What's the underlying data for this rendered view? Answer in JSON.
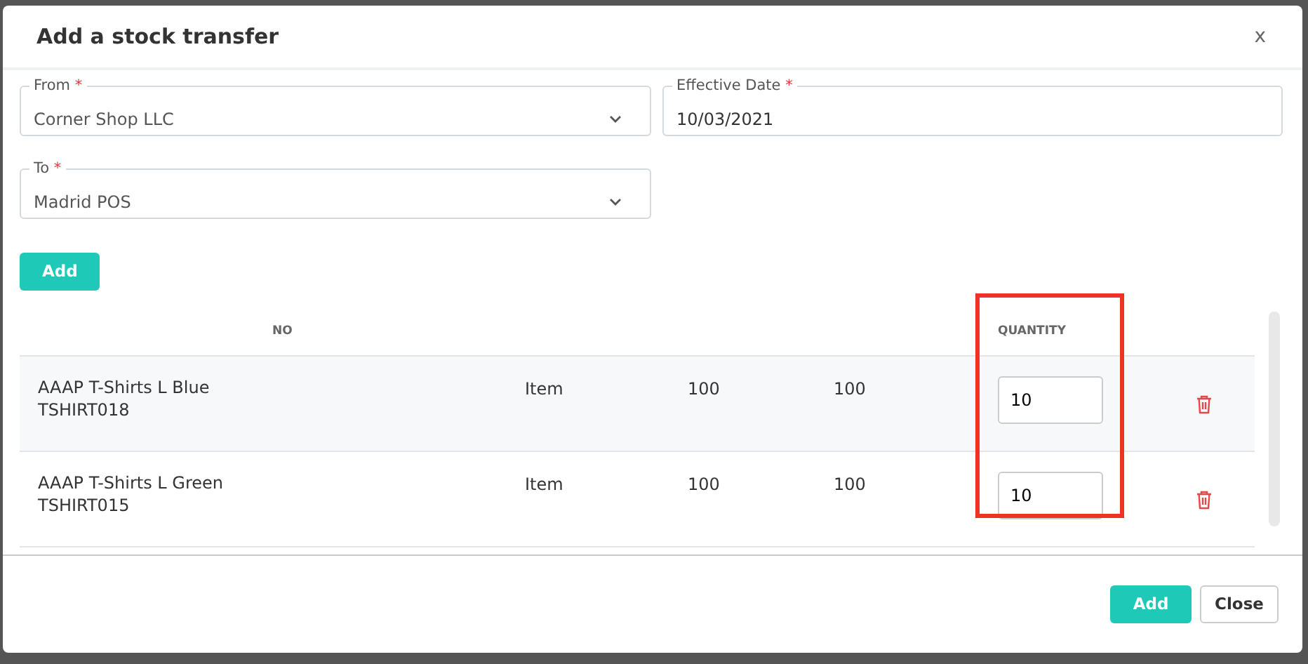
{
  "dialog": {
    "title": "Add a stock transfer",
    "close": "x"
  },
  "fields": [
    {
      "label": "From",
      "required_mark": "*",
      "kind": "select",
      "value": "Corner Shop LLC"
    },
    {
      "label": "Effective Date",
      "required_mark": "*",
      "kind": "text",
      "value": "10/03/2021"
    },
    {
      "label": "To",
      "required_mark": "*",
      "kind": "select",
      "value": "Madrid POS"
    }
  ],
  "add_line_button": "Add",
  "table": {
    "columns": [
      {
        "label": "NO",
        "highlighted": false
      },
      {
        "label": "QUANTITY",
        "highlighted": true
      }
    ],
    "rows": [
      {
        "name": "AAAP T-Shirts L Blue",
        "sku": "TSHIRT018",
        "type": "Item",
        "column_3": "100",
        "column_4": "100",
        "quantity": "10",
        "shaded": true
      },
      {
        "name": "AAAP T-Shirts L Green",
        "sku": "TSHIRT015",
        "type": "Item",
        "column_3": "100",
        "column_4": "100",
        "quantity": "10",
        "shaded": false
      }
    ]
  },
  "buttons": [
    {
      "label": "Add",
      "kind": "primary"
    },
    {
      "label": "Close",
      "kind": "secondary"
    }
  ]
}
